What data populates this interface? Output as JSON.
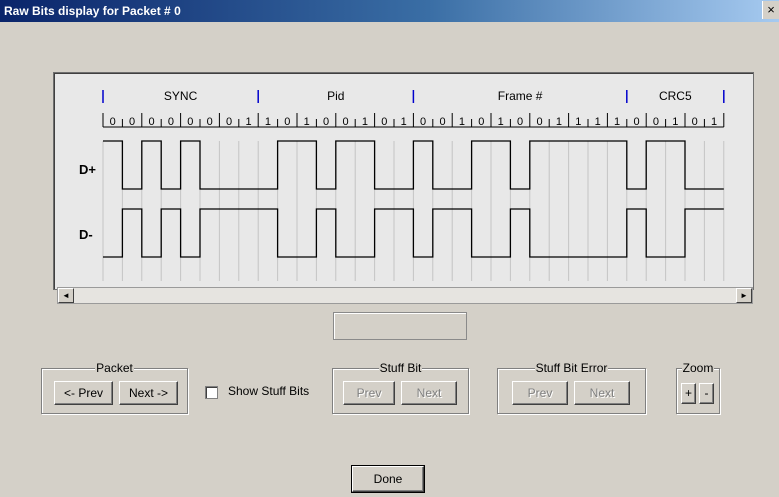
{
  "window": {
    "title": "Raw Bits display for Packet # 0",
    "close": "×"
  },
  "waveform": {
    "fields": [
      "SYNC",
      "Pid",
      "Frame #",
      "CRC5"
    ],
    "bits": [
      "0",
      "0",
      "0",
      "0",
      "0",
      "0",
      "0",
      "1",
      "1",
      "0",
      "1",
      "0",
      "0",
      "1",
      "0",
      "1",
      "0",
      "0",
      "1",
      "0",
      "1",
      "0",
      "0",
      "1",
      "1",
      "1",
      "1",
      "0",
      "0",
      "1",
      "0",
      "1"
    ],
    "signals": [
      "D+",
      "D-"
    ],
    "dplus_levels": [
      1,
      0,
      1,
      0,
      1,
      0,
      0,
      0,
      0,
      1,
      1,
      0,
      1,
      1,
      0,
      0,
      1,
      0,
      0,
      1,
      1,
      0,
      1,
      1,
      1,
      1,
      1,
      0,
      1,
      1,
      0,
      0
    ]
  },
  "scrollbar": {
    "left": "◄",
    "right": "►"
  },
  "packet_group": {
    "label": "Packet",
    "prev": "<- Prev",
    "next": "Next ->"
  },
  "show_stuff_bits": {
    "label": "Show Stuff Bits",
    "checked": false
  },
  "stuff_bit_group": {
    "label": "Stuff Bit",
    "prev": "Prev",
    "next": "Next"
  },
  "stuff_bit_error_group": {
    "label": "Stuff Bit Error",
    "prev": "Prev",
    "next": "Next"
  },
  "zoom_group": {
    "label": "Zoom",
    "plus": "+",
    "minus": "-"
  },
  "done": "Done"
}
